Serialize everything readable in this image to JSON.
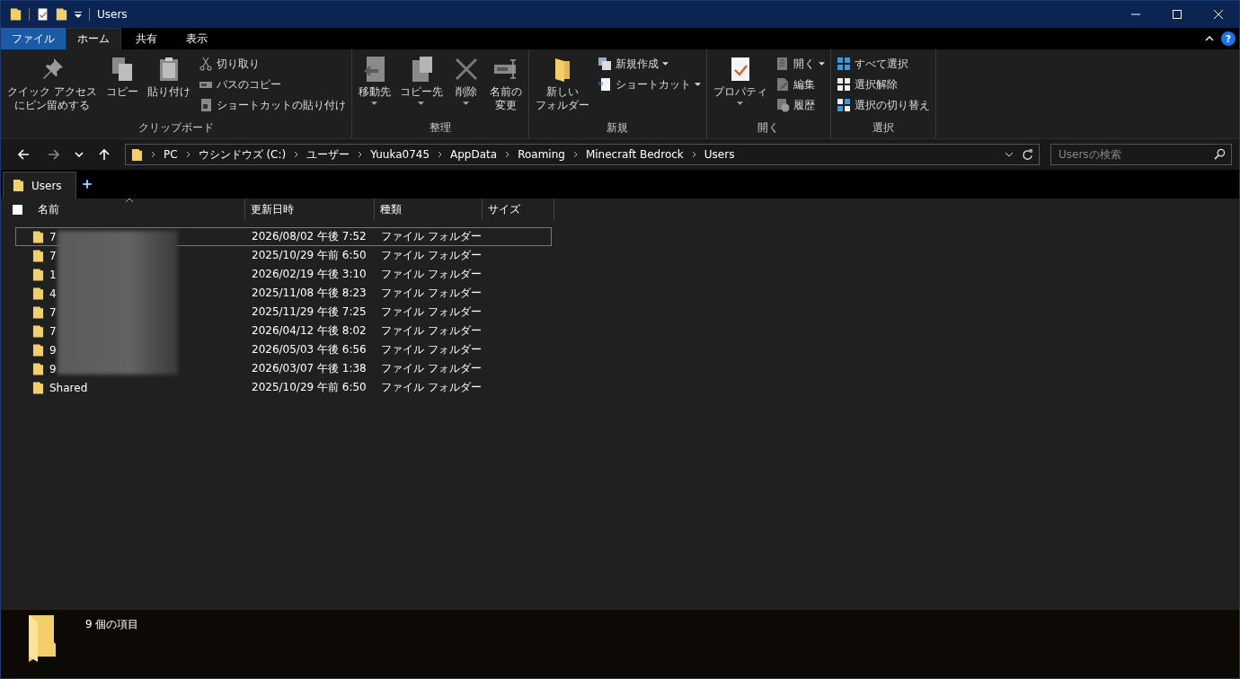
{
  "window": {
    "title": "Users"
  },
  "ribbon_tabs": [
    {
      "label": "ファイル",
      "kind": "file",
      "selected": false
    },
    {
      "label": "ホーム",
      "kind": "tab",
      "selected": true
    },
    {
      "label": "共有",
      "kind": "tab",
      "selected": false
    },
    {
      "label": "表示",
      "kind": "tab",
      "selected": false
    }
  ],
  "help": {
    "label": "?"
  },
  "ribbon": {
    "groups": [
      {
        "label": "クリップボード",
        "items": [
          {
            "lines": [
              "クイック アクセス",
              "にピン留めする"
            ],
            "kind": "large",
            "dropdown": false
          },
          {
            "lines": [
              "コピー"
            ],
            "kind": "large",
            "dropdown": false
          },
          {
            "lines": [
              "貼り付け"
            ],
            "kind": "large",
            "dropdown": false
          },
          {
            "label": "切り取り",
            "kind": "small",
            "dropdown": false
          },
          {
            "label": "パスのコピー",
            "kind": "small",
            "dropdown": false
          },
          {
            "label": "ショートカットの貼り付け",
            "kind": "small",
            "dropdown": false
          }
        ]
      },
      {
        "label": "整理",
        "items": [
          {
            "lines": [
              "移動先"
            ],
            "kind": "large",
            "dropdown": true
          },
          {
            "lines": [
              "コピー先"
            ],
            "kind": "large",
            "dropdown": true
          },
          {
            "lines": [
              "削除"
            ],
            "kind": "large",
            "dropdown": true
          },
          {
            "lines": [
              "名前の",
              "変更"
            ],
            "kind": "large",
            "dropdown": false
          }
        ]
      },
      {
        "label": "新規",
        "items": [
          {
            "lines": [
              "新しい",
              "フォルダー"
            ],
            "kind": "large",
            "dropdown": false
          },
          {
            "label": "新規作成",
            "kind": "small",
            "dropdown": true
          },
          {
            "label": "ショートカット",
            "kind": "small",
            "dropdown": true
          }
        ]
      },
      {
        "label": "開く",
        "items": [
          {
            "lines": [
              "プロパティ"
            ],
            "kind": "large",
            "dropdown": true
          },
          {
            "label": "開く",
            "kind": "small",
            "dropdown": true
          },
          {
            "label": "編集",
            "kind": "small",
            "dropdown": false
          },
          {
            "label": "履歴",
            "kind": "small",
            "dropdown": false
          }
        ]
      },
      {
        "label": "選択",
        "items": [
          {
            "label": "すべて選択",
            "kind": "small",
            "dropdown": false
          },
          {
            "label": "選択解除",
            "kind": "small",
            "dropdown": false
          },
          {
            "label": "選択の切り替え",
            "kind": "small",
            "dropdown": false
          }
        ]
      }
    ]
  },
  "address_bar": {
    "path": [
      "PC",
      "ウシンドウズ (C:)",
      "ユーザー",
      "Yuuka0745",
      "AppData",
      "Roaming",
      "Minecraft Bedrock",
      "Users"
    ]
  },
  "search": {
    "placeholder": "Usersの検索"
  },
  "tabs": [
    {
      "label": "Users",
      "selected": true
    }
  ],
  "table": {
    "select_all": {
      "checked": false
    },
    "columns": [
      {
        "label": "名前",
        "sorted": true
      },
      {
        "label": "更新日時",
        "sorted": false
      },
      {
        "label": "種類",
        "sorted": false
      },
      {
        "label": "サイズ",
        "sorted": false
      }
    ],
    "rows": [
      {
        "name": "7",
        "modified": "2026/08/02 午後 7:52",
        "type": "ファイル フォルダー",
        "focused": true
      },
      {
        "name": "7",
        "modified": "2025/10/29 午前 6:50",
        "type": "ファイル フォルダー",
        "focused": false
      },
      {
        "name": "1",
        "modified": "2026/02/19 午後 3:10",
        "type": "ファイル フォルダー",
        "focused": false
      },
      {
        "name": "4",
        "modified": "2025/11/08 午後 8:23",
        "type": "ファイル フォルダー",
        "focused": false
      },
      {
        "name": "7",
        "modified": "2025/11/29 午後 7:25",
        "type": "ファイル フォルダー",
        "focused": false
      },
      {
        "name": "7",
        "modified": "2026/04/12 午後 8:02",
        "type": "ファイル フォルダー",
        "focused": false
      },
      {
        "name": "9",
        "modified": "2026/05/03 午後 6:56",
        "type": "ファイル フォルダー",
        "focused": false
      },
      {
        "name": "9",
        "modified": "2026/03/07 午後 1:38",
        "type": "ファイル フォルダー",
        "focused": false
      },
      {
        "name": "Shared",
        "modified": "2025/10/29 午前 6:50",
        "type": "ファイル フォルダー",
        "focused": false
      }
    ]
  },
  "status_bar": {
    "text": "9 個の項目"
  }
}
